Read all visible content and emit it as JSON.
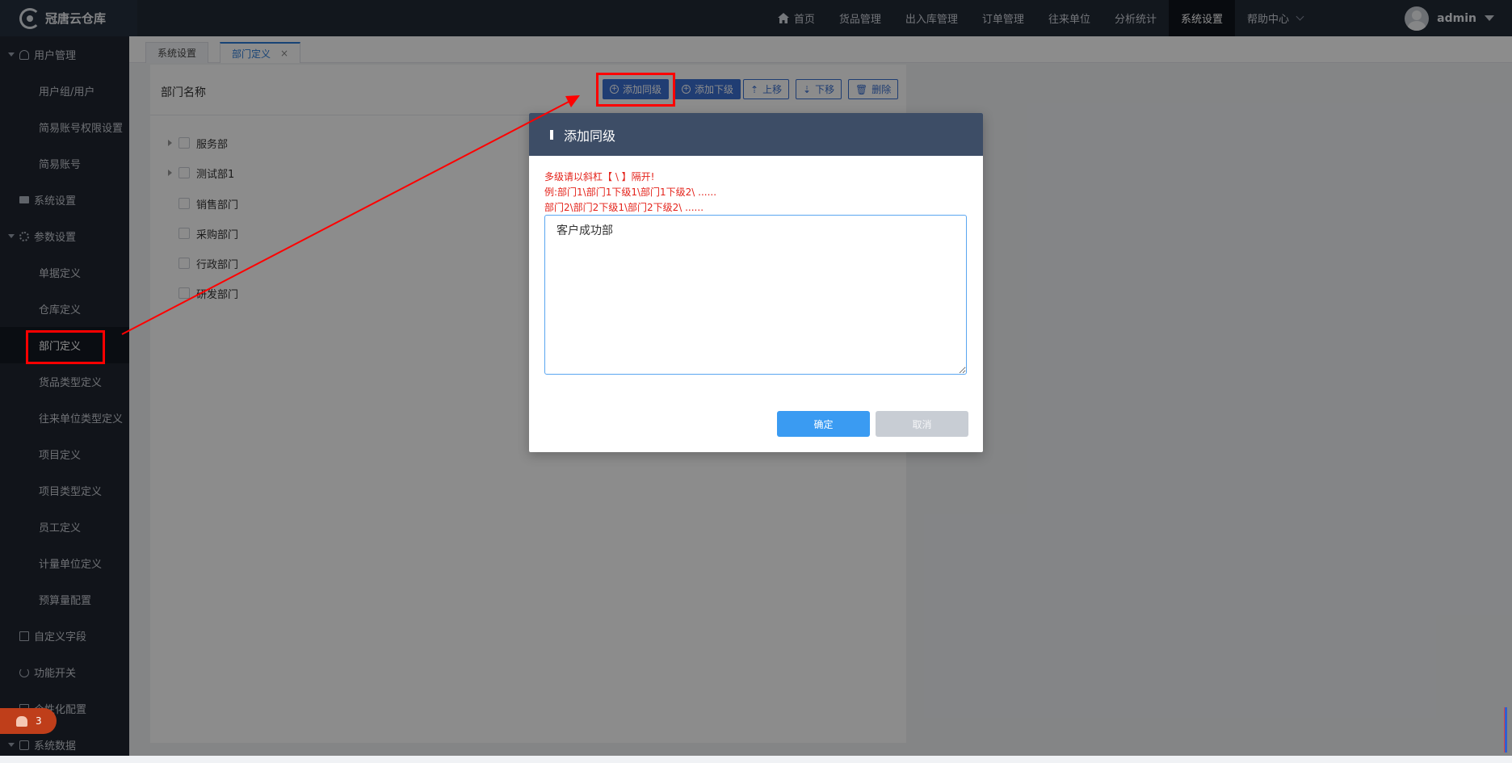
{
  "app": {
    "name": "冠唐云仓库"
  },
  "nav": {
    "items": [
      "首页",
      "货品管理",
      "出入库管理",
      "订单管理",
      "往来单位",
      "分析统计",
      "系统设置",
      "帮助中心"
    ],
    "active": "系统设置",
    "user": "admin"
  },
  "sidebar": {
    "items": [
      {
        "label": "用户管理",
        "type": "parent"
      },
      {
        "label": "用户组/用户",
        "type": "child"
      },
      {
        "label": "简易账号权限设置",
        "type": "child"
      },
      {
        "label": "简易账号",
        "type": "child"
      },
      {
        "label": "系统设置",
        "type": "parent"
      },
      {
        "label": "参数设置",
        "type": "parent"
      },
      {
        "label": "单据定义",
        "type": "child"
      },
      {
        "label": "仓库定义",
        "type": "child"
      },
      {
        "label": "部门定义",
        "type": "child",
        "active": true
      },
      {
        "label": "货品类型定义",
        "type": "child"
      },
      {
        "label": "往来单位类型定义",
        "type": "child"
      },
      {
        "label": "项目定义",
        "type": "child"
      },
      {
        "label": "项目类型定义",
        "type": "child"
      },
      {
        "label": "员工定义",
        "type": "child"
      },
      {
        "label": "计量单位定义",
        "type": "child"
      },
      {
        "label": "预算量配置",
        "type": "child"
      },
      {
        "label": "自定义字段",
        "type": "parent"
      },
      {
        "label": "功能开关",
        "type": "parent"
      },
      {
        "label": "个性化配置",
        "type": "parent"
      },
      {
        "label": "系统数据",
        "type": "parent"
      }
    ]
  },
  "tabs": {
    "items": [
      {
        "label": "系统设置"
      },
      {
        "label": "部门定义",
        "active": true,
        "close": "×"
      }
    ]
  },
  "content": {
    "column_title": "部门名称",
    "toolbar": {
      "add_sibling": "添加同级",
      "add_child": "添加下级",
      "move_up": "上移",
      "move_down": "下移",
      "delete": "删除"
    },
    "tree": [
      {
        "label": "服务部",
        "expandable": true
      },
      {
        "label": "测试部1",
        "expandable": true
      },
      {
        "label": "销售部门",
        "expandable": false
      },
      {
        "label": "采购部门",
        "expandable": false
      },
      {
        "label": "行政部门",
        "expandable": false
      },
      {
        "label": "研发部门",
        "expandable": false
      }
    ]
  },
  "modal": {
    "title": "添加同级",
    "hints": [
      "多级请以斜杠【 \\ 】隔开!",
      "例:部门1\\部门1下级1\\部门1下级2\\ ......",
      "部门2\\部门2下级1\\部门2下级2\\ ......"
    ],
    "input_value": "客户成功部",
    "ok_label": "确定",
    "cancel_label": "取消"
  },
  "notice": {
    "count": "3"
  },
  "colors": {
    "topbar": "#222a36",
    "sidebar": "#1f2631",
    "primary": "#3b6fd1",
    "modal_header": "#3d4d66",
    "ok_button": "#3a9bf2",
    "hint_text": "#e4231b",
    "annotation": "#ff0000"
  }
}
